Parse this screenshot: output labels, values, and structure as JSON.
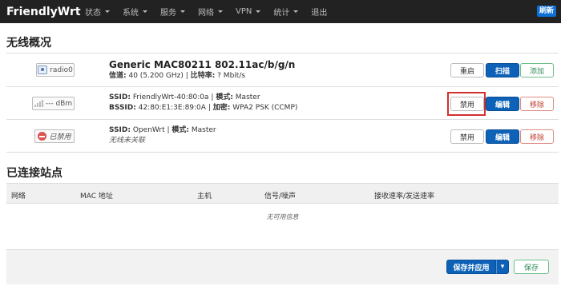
{
  "navbar": {
    "brand": "FriendlyWrt",
    "menu": [
      {
        "label": "状态",
        "dropdown": true
      },
      {
        "label": "系统",
        "dropdown": true
      },
      {
        "label": "服务",
        "dropdown": true
      },
      {
        "label": "网络",
        "dropdown": true
      },
      {
        "label": "VPN",
        "dropdown": true
      },
      {
        "label": "统计",
        "dropdown": true
      },
      {
        "label": "退出",
        "dropdown": false
      }
    ],
    "refresh_label": "刷新"
  },
  "wireless": {
    "heading": "无线概况",
    "radio": {
      "badge": "radio0",
      "title": "Generic MAC80211 802.11ac/b/g/n",
      "channel_label": "信道:",
      "channel_value": "40 (5.200 GHz)",
      "rate_label": "比特率:",
      "rate_value": "? Mbit/s",
      "buttons": {
        "restart": "重启",
        "scan": "扫描",
        "add": "添加"
      }
    },
    "networks": [
      {
        "badge": "--- dBm",
        "ssid_label": "SSID:",
        "ssid": "FriendlyWrt-40:80:0a",
        "mode_label": "模式:",
        "mode": "Master",
        "bssid_label": "BSSID:",
        "bssid": "42:80:E1:3E:89:0A",
        "enc_label": "加密:",
        "encryption": "WPA2 PSK (CCMP)",
        "buttons": {
          "disable": "禁用",
          "edit": "编辑",
          "remove": "移除"
        }
      },
      {
        "badge": "已禁用",
        "ssid_label": "SSID:",
        "ssid": "OpenWrt",
        "mode_label": "模式:",
        "mode": "Master",
        "note": "无线未关联",
        "buttons": {
          "disable": "禁用",
          "edit": "编辑",
          "remove": "移除"
        }
      }
    ]
  },
  "stations": {
    "heading": "已连接站点",
    "columns": [
      "网络",
      "MAC 地址",
      "主机",
      "信号/噪声",
      "接收速率/发送速率"
    ],
    "empty": "无可用信息"
  },
  "footer": {
    "save_apply": "保存并应用",
    "dropdown_icon": "▾",
    "save": "保存"
  },
  "colors": {
    "primary": "#0d62b8",
    "navbar": "#222222",
    "highlight": "#d32f2f"
  }
}
